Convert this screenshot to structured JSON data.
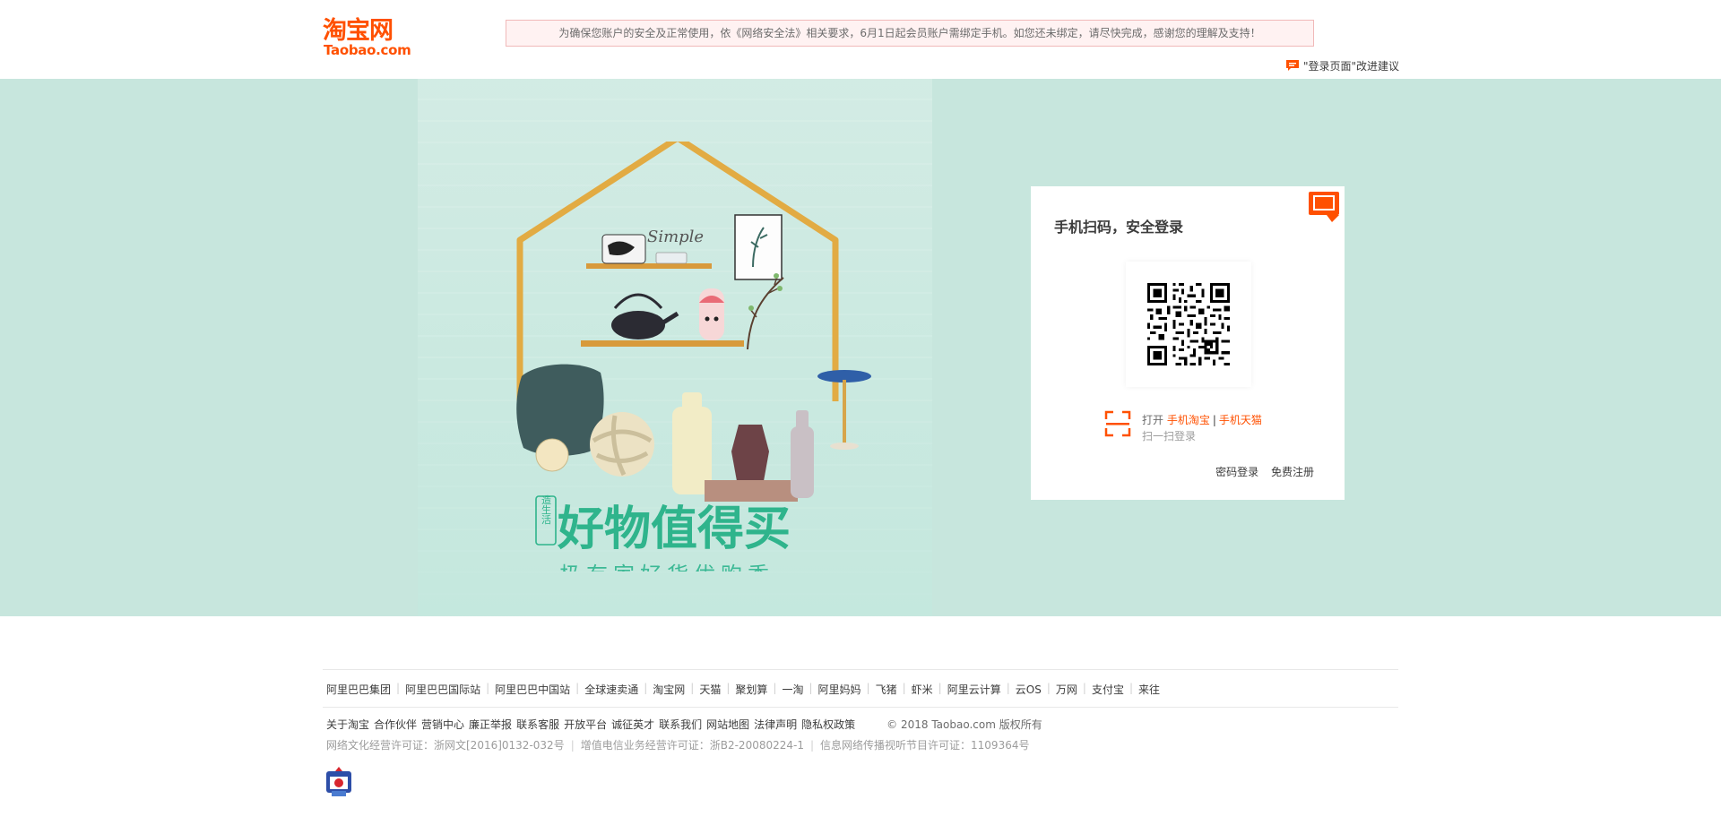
{
  "header": {
    "logo_cn": "淘宝网",
    "logo_en": "Taobao.com",
    "notice": "为确保您账户的安全及正常使用，依《网络安全法》相关要求，6月1日起会员账户需绑定手机。如您还未绑定，请尽快完成，感谢您的理解及支持！",
    "feedback_label": "\"登录页面\"改进建议",
    "brand_color": "#ff5000"
  },
  "banner": {
    "background_color": "#c7e6dd",
    "seal_text": "造生活",
    "headline": "好物值得买",
    "subheadline": "极有家好货优购季",
    "script_text": "Simple",
    "accent_color": "#2fb48c"
  },
  "login": {
    "title": "手机扫码，安全登录",
    "switch_icon": "monitor-icon",
    "scan_prefix": "打开",
    "scan_app1": "手机淘宝",
    "scan_sep": "|",
    "scan_app2": "手机天猫",
    "scan_action": "扫一扫登录",
    "password_login": "密码登录",
    "register": "免费注册"
  },
  "footer": {
    "links_primary": [
      "阿里巴巴集团",
      "阿里巴巴国际站",
      "阿里巴巴中国站",
      "全球速卖通",
      "淘宝网",
      "天猫",
      "聚划算",
      "一淘",
      "阿里妈妈",
      "飞猪",
      "虾米",
      "阿里云计算",
      "云OS",
      "万网",
      "支付宝",
      "来往"
    ],
    "links_secondary": [
      "关于淘宝",
      "合作伙伴",
      "营销中心",
      "廉正举报",
      "联系客服",
      "开放平台",
      "诚征英才",
      "联系我们",
      "网站地图",
      "法律声明",
      "隐私权政策"
    ],
    "copyright": "© 2018 Taobao.com 版权所有",
    "licenses": [
      "网络文化经营许可证：浙网文[2016]0132-032号",
      "增值电信业务经营许可证：浙B2-20080224-1",
      "信息网络传播视听节目许可证：1109364号"
    ],
    "badge_icon": "police-badge-icon"
  }
}
